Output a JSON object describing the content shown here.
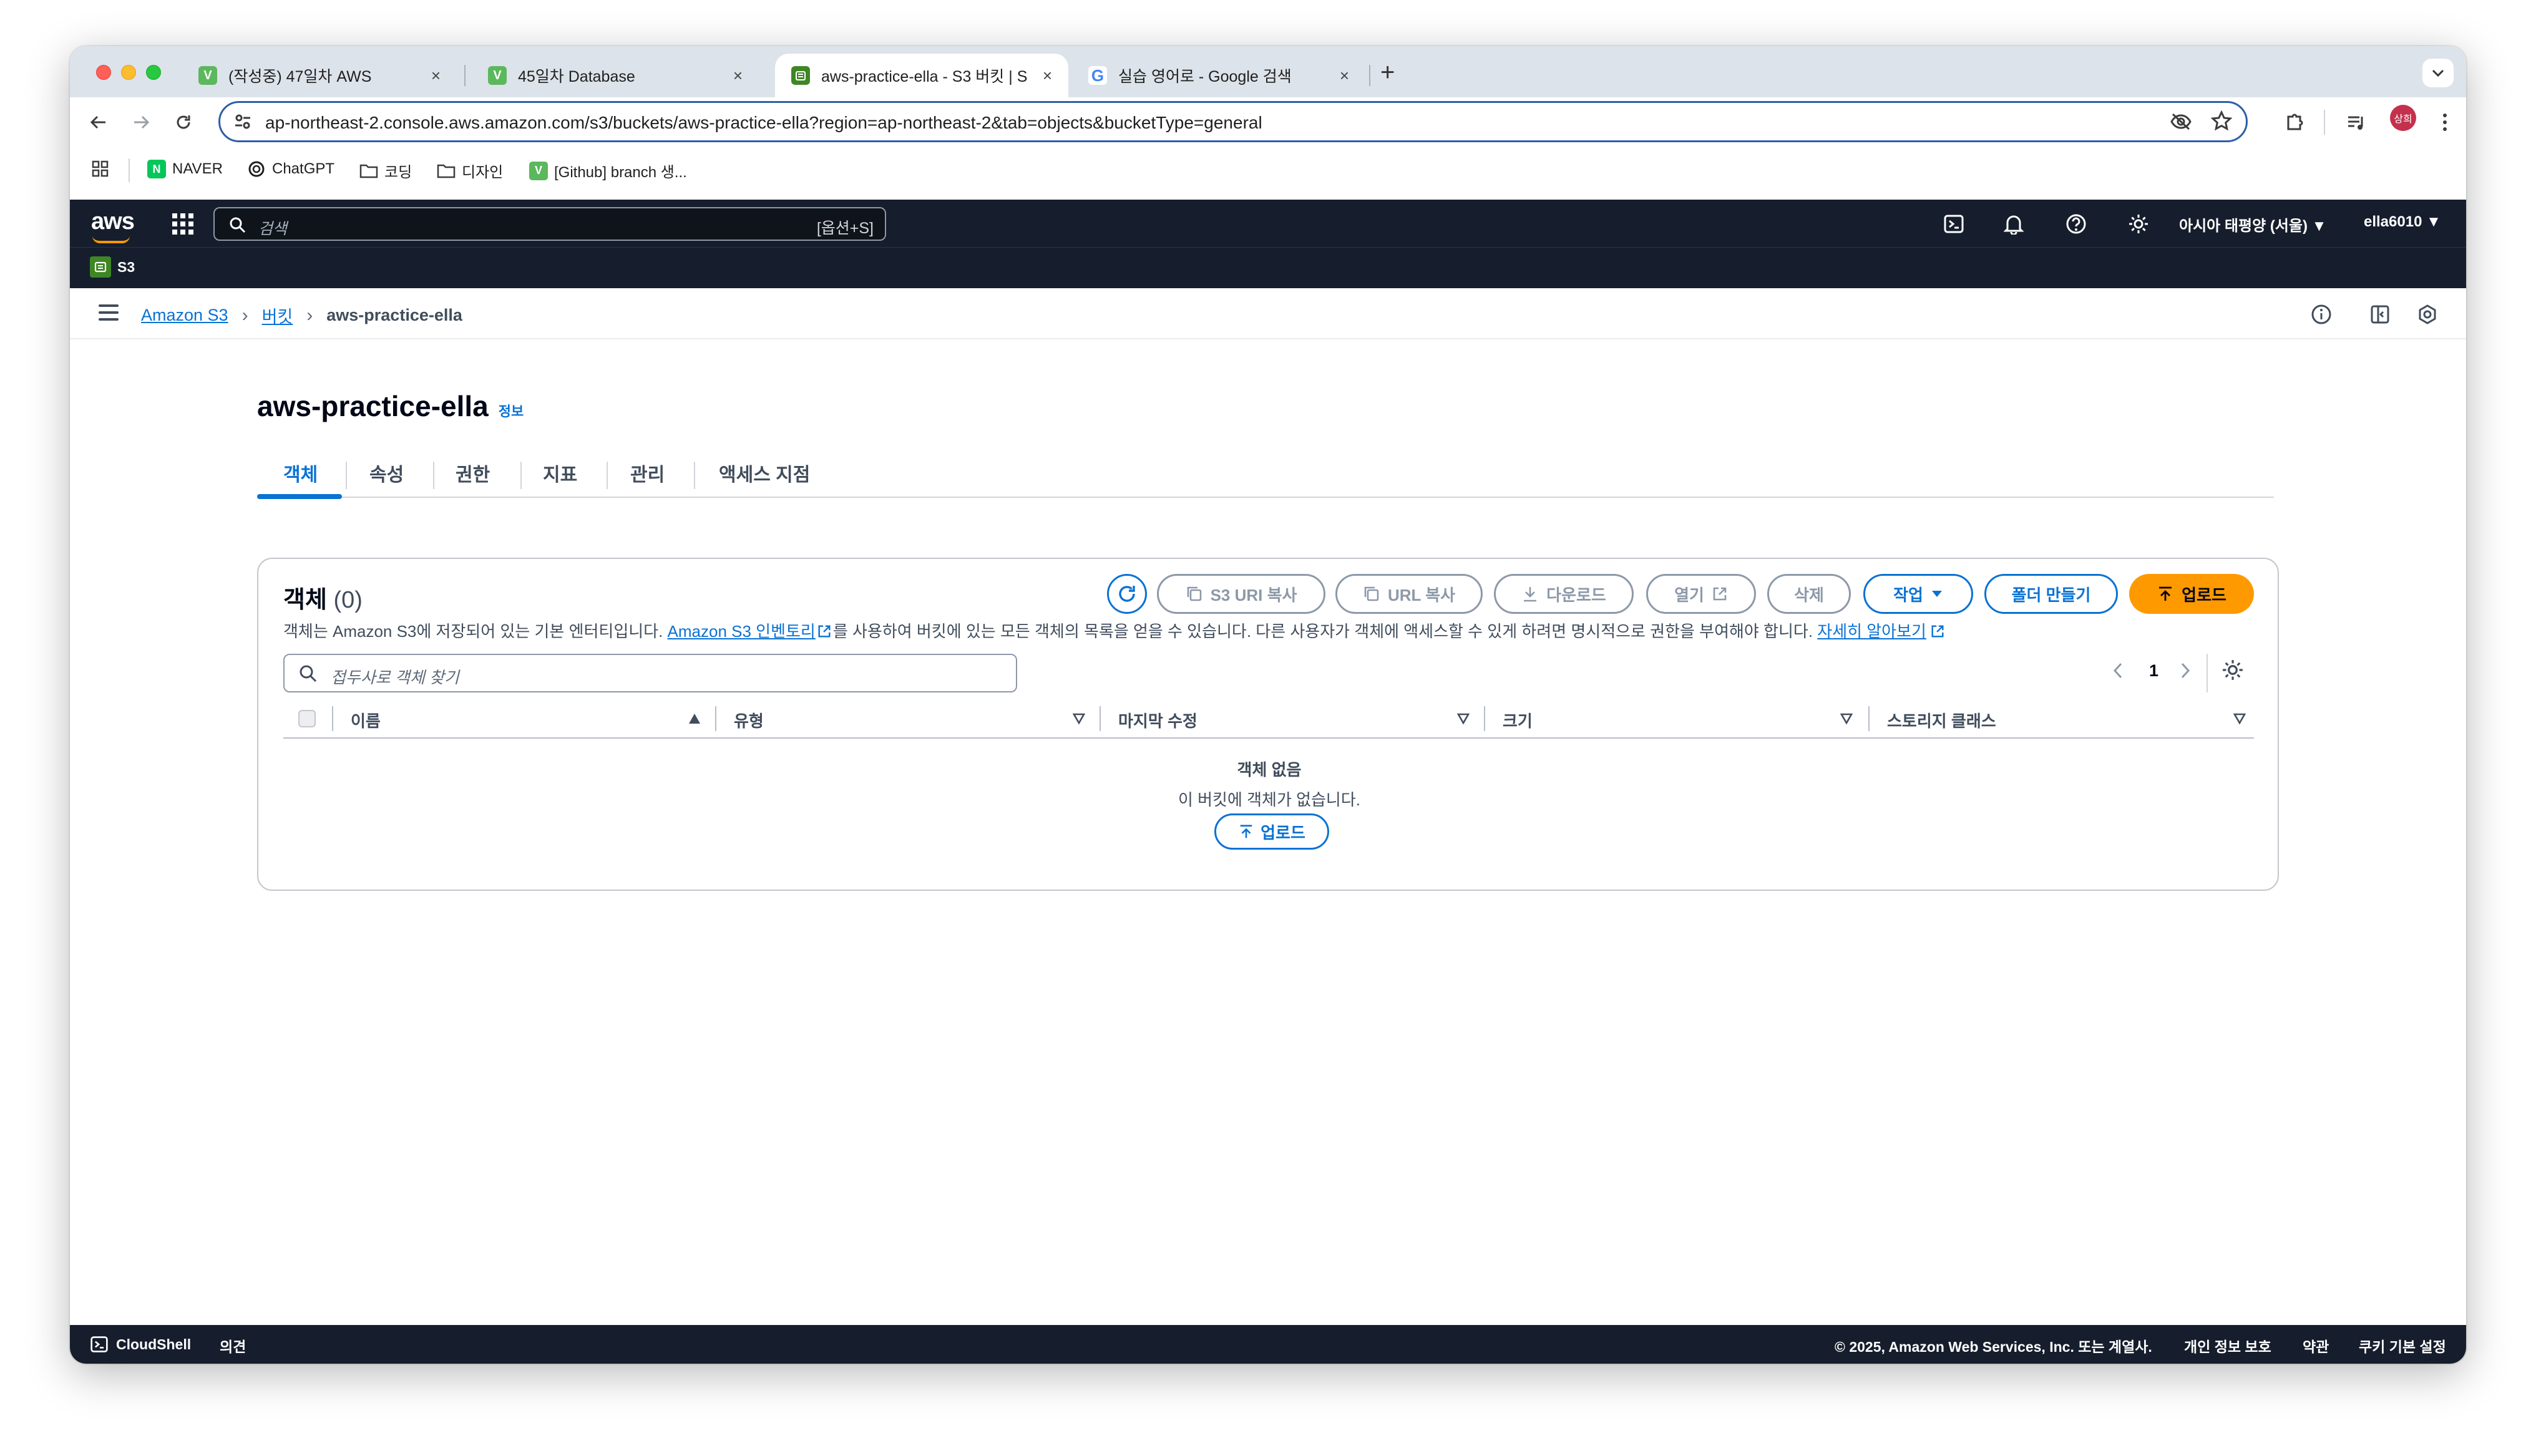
{
  "browser": {
    "tabs": [
      {
        "title": "(작성중) 47일차 AWS",
        "favicon": "V",
        "active": false
      },
      {
        "title": "45일차 Database",
        "favicon": "V",
        "active": false
      },
      {
        "title": "aws-practice-ella - S3 버킷 | S",
        "favicon": "S3",
        "active": true
      },
      {
        "title": "실습 영어로 - Google 검색",
        "favicon": "G",
        "active": false
      }
    ],
    "url": "ap-northeast-2.console.aws.amazon.com/s3/buckets/aws-practice-ella?region=ap-northeast-2&tab=objects&bucketType=general",
    "profile_initial": "상희",
    "bookmarks": [
      {
        "label": "NAVER",
        "icon": "naver-icon"
      },
      {
        "label": "ChatGPT",
        "icon": "chatgpt-icon"
      },
      {
        "label": "코딩",
        "icon": "folder-icon"
      },
      {
        "label": "디자인",
        "icon": "folder-icon"
      },
      {
        "label": "[Github] branch 생...",
        "icon": "velog-icon"
      }
    ]
  },
  "aws": {
    "logo": "aws",
    "search_placeholder": "검색",
    "search_shortcut": "[옵션+S]",
    "region": "아시아 태평양 (서울) ▼",
    "account": "ella6010 ▼",
    "service": "S3"
  },
  "breadcrumb": {
    "items": [
      "Amazon S3",
      "버킷"
    ],
    "current": "aws-practice-ella"
  },
  "page": {
    "title": "aws-practice-ella",
    "info": "정보",
    "tabs": [
      "객체",
      "속성",
      "권한",
      "지표",
      "관리",
      "액세스 지점"
    ]
  },
  "objects": {
    "title": "객체",
    "count": "(0)",
    "desc_before": "객체는 Amazon S3에 저장되어 있는 기본 엔터티입니다. ",
    "desc_link1": "Amazon S3 인벤토리",
    "desc_middle": "를 사용하여 버킷에 있는 모든 객체의 목록을 얻을 수 있습니다. 다른 사용자가 객체에 액세스할 수 있게 하려면 명시적으로 권한을 부여해야 합니다. ",
    "desc_link2": "자세히 알아보기",
    "buttons": {
      "copy_s3_uri": "S3 URI 복사",
      "copy_url": "URL 복사",
      "download": "다운로드",
      "open": "열기",
      "delete": "삭제",
      "actions": "작업",
      "create_folder": "폴더 만들기",
      "upload": "업로드"
    },
    "search_placeholder": "접두사로 객체 찾기",
    "page_number": "1",
    "columns": [
      "이름",
      "유형",
      "마지막 수정",
      "크기",
      "스토리지 클래스"
    ],
    "empty_title": "객체 없음",
    "empty_desc": "이 버킷에 객체가 없습니다.",
    "empty_upload": "업로드"
  },
  "footer": {
    "cloudshell": "CloudShell",
    "feedback": "의견",
    "copyright": "© 2025, Amazon Web Services, Inc. 또는 계열사.",
    "privacy": "개인 정보 보호",
    "terms": "약관",
    "cookies": "쿠키 기본 설정"
  },
  "colors": {
    "aws_nav": "#161e2d",
    "link_blue": "#0972d3",
    "primary_orange": "#ff9900",
    "s3_green": "#3f8624"
  }
}
